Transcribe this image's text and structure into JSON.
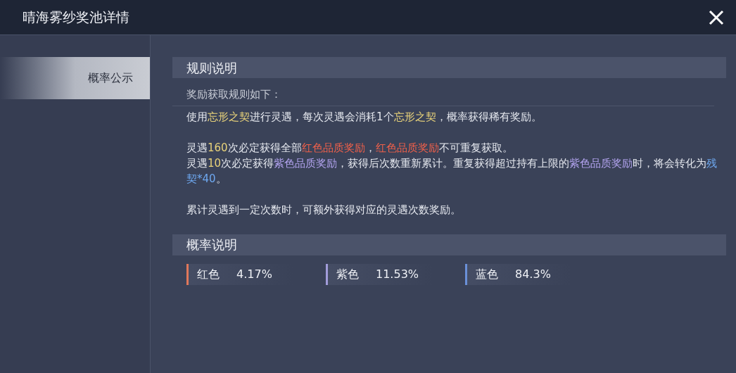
{
  "window": {
    "title": "晴海雾纱奖池详情"
  },
  "sidebar": {
    "items": [
      {
        "label": "概率公示",
        "selected": true
      }
    ]
  },
  "rules": {
    "title": "规则说明",
    "subtitle": "奖励获取规则如下：",
    "groups": [
      [
        [
          {
            "text": "使用"
          },
          {
            "text": "忘形之契",
            "color": "#e8d27a"
          },
          {
            "text": "进行灵遇，每次灵遇会消耗1个"
          },
          {
            "text": "忘形之契",
            "color": "#e8d27a"
          },
          {
            "text": "，概率获得稀有奖励。"
          }
        ]
      ],
      [
        [
          {
            "text": "灵遇"
          },
          {
            "text": "160",
            "color": "#e8d27a"
          },
          {
            "text": "次必定获得全部"
          },
          {
            "text": "红色品质奖励",
            "color": "#f0604a"
          },
          {
            "text": "，"
          },
          {
            "text": "红色品质奖励",
            "color": "#f0604a"
          },
          {
            "text": "不可重复获取。"
          }
        ],
        [
          {
            "text": "灵遇"
          },
          {
            "text": "10",
            "color": "#e8d27a"
          },
          {
            "text": "次必定获得"
          },
          {
            "text": "紫色品质奖励",
            "color": "#b3a4f0"
          },
          {
            "text": "，获得后次数重新累计。重复获得超过持有上限的"
          },
          {
            "text": "紫色品质奖励",
            "color": "#b3a4f0"
          },
          {
            "text": "时，将会转化为"
          },
          {
            "text": "残契*40",
            "color": "#6ea8f0"
          },
          {
            "text": "。"
          }
        ]
      ],
      [
        [
          {
            "text": "累计灵遇到一定次数时，可额外获得对应的灵遇次数奖励。"
          }
        ]
      ]
    ]
  },
  "probability": {
    "title": "概率说明",
    "items": [
      {
        "label": "红色",
        "value": "4.17%",
        "color": "#e0775a"
      },
      {
        "label": "紫色",
        "value": "11.53%",
        "color": "#a29cda"
      },
      {
        "label": "蓝色",
        "value": "84.3%",
        "color": "#6a90d8"
      }
    ]
  }
}
